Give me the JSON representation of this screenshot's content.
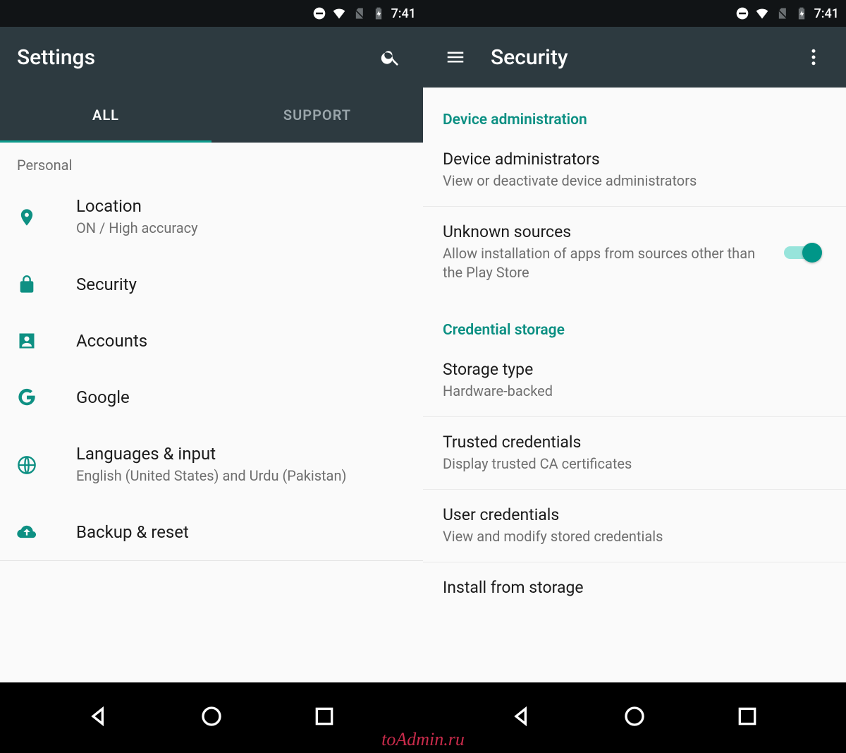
{
  "status": {
    "time": "7:41"
  },
  "left": {
    "title": "Settings",
    "tabs": {
      "all": "ALL",
      "support": "SUPPORT"
    },
    "category": "Personal",
    "items": [
      {
        "title": "Location",
        "sub": "ON / High accuracy"
      },
      {
        "title": "Security",
        "sub": ""
      },
      {
        "title": "Accounts",
        "sub": ""
      },
      {
        "title": "Google",
        "sub": ""
      },
      {
        "title": "Languages & input",
        "sub": "English (United States) and Urdu (Pakistan)"
      },
      {
        "title": "Backup & reset",
        "sub": ""
      }
    ]
  },
  "right": {
    "title": "Security",
    "sections": {
      "device_admin": "Device administration",
      "cred_storage": "Credential storage"
    },
    "items": {
      "dev_admins": {
        "title": "Device administrators",
        "sub": "View or deactivate device administrators"
      },
      "unknown": {
        "title": "Unknown sources",
        "sub": "Allow installation of apps from sources other than the Play Store",
        "enabled": true
      },
      "storage_type": {
        "title": "Storage type",
        "sub": "Hardware-backed"
      },
      "trusted": {
        "title": "Trusted credentials",
        "sub": "Display trusted CA certificates"
      },
      "user_creds": {
        "title": "User credentials",
        "sub": "View and modify stored credentials"
      },
      "install": {
        "title": "Install from storage",
        "sub": ""
      }
    }
  },
  "watermark": "toAdmin.ru"
}
